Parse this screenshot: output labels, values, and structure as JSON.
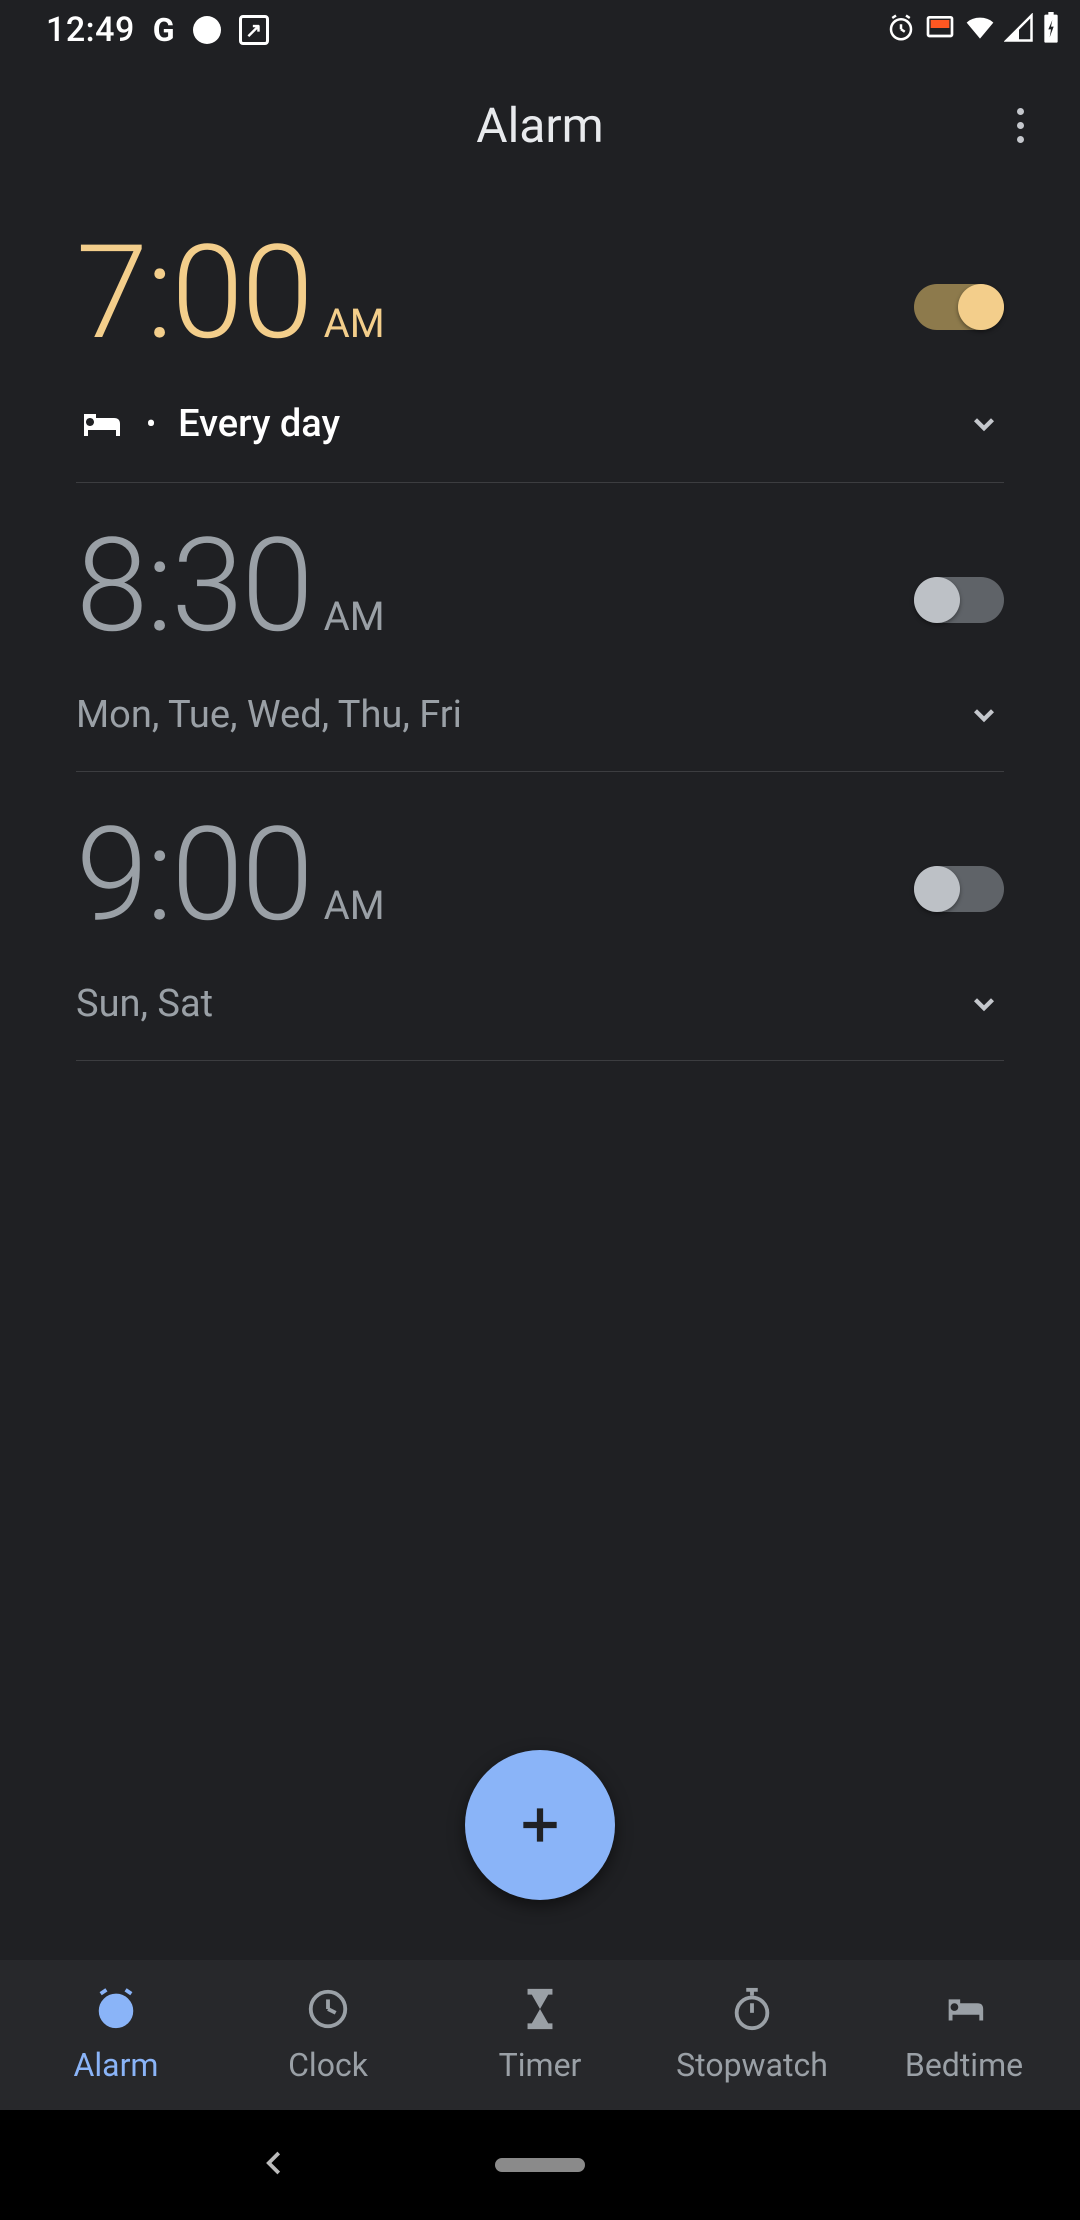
{
  "status": {
    "time": "12:49",
    "icons_left": [
      "g-icon",
      "record-dot",
      "screenshot-icon"
    ],
    "icons_right": [
      "alarm-icon",
      "cast-icon",
      "wifi-icon",
      "signal-icon",
      "battery-charging-icon"
    ]
  },
  "header": {
    "title": "Alarm"
  },
  "alarms": [
    {
      "time": "7:00",
      "ampm": "AM",
      "enabled": true,
      "has_bedtime": true,
      "schedule": "Every day"
    },
    {
      "time": "8:30",
      "ampm": "AM",
      "enabled": false,
      "has_bedtime": false,
      "schedule": "Mon, Tue, Wed, Thu, Fri"
    },
    {
      "time": "9:00",
      "ampm": "AM",
      "enabled": false,
      "has_bedtime": false,
      "schedule": "Sun, Sat"
    }
  ],
  "nav": {
    "items": [
      {
        "label": "Alarm",
        "icon": "alarm-clock-icon",
        "active": true
      },
      {
        "label": "Clock",
        "icon": "clock-icon",
        "active": false
      },
      {
        "label": "Timer",
        "icon": "hourglass-icon",
        "active": false
      },
      {
        "label": "Stopwatch",
        "icon": "stopwatch-icon",
        "active": false
      },
      {
        "label": "Bedtime",
        "icon": "bed-icon",
        "active": false
      }
    ]
  },
  "colors": {
    "accent_warm": "#f3ce8b",
    "accent_blue": "#8ab4f8",
    "bg": "#1f2023",
    "nav_bg": "#27282b",
    "text_muted": "#9aa0a6"
  }
}
